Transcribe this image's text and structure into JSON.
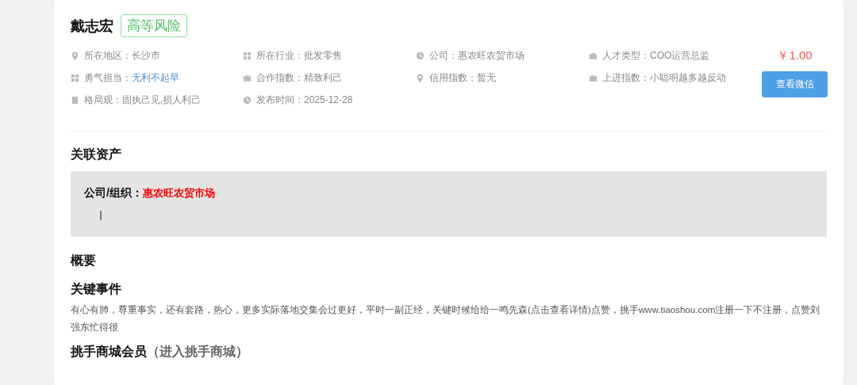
{
  "profile": {
    "name": "戴志宏",
    "risk_tag": "高等风险",
    "price": "￥1.00",
    "button": "查看微信",
    "fields": [
      {
        "kind": "pin",
        "label": "所在地区：",
        "value": "长沙市",
        "link": false
      },
      {
        "kind": "grid",
        "label": "所在行业：",
        "value": "批发零售",
        "link": false
      },
      {
        "kind": "clock",
        "label": "公司：",
        "value": "惠农旺农贸市场",
        "link": false
      },
      {
        "kind": "briefcase",
        "label": "人才类型：",
        "value": "COO运营总监",
        "link": false
      },
      {
        "kind": "grid",
        "label": "勇气担当：",
        "value": "无利不起早",
        "link": true
      },
      {
        "kind": "briefcase",
        "label": "合作指数：",
        "value": "精致利己",
        "link": false
      },
      {
        "kind": "pin",
        "label": "信用指数：",
        "value": "暂无",
        "link": false
      },
      {
        "kind": "briefcase",
        "label": "上进指数：",
        "value": "小聪明越多越反动",
        "link": false
      },
      {
        "kind": "doc",
        "label": "格局观：",
        "value": "固执己见,损人利己",
        "link": false
      },
      {
        "kind": "clock",
        "label": "发布时间：",
        "value": "2025-12-28",
        "link": false
      }
    ]
  },
  "assets": {
    "heading": "关联资产",
    "label": "公司/组织：",
    "value": "惠农旺农贸市场"
  },
  "summary": {
    "heading": "概要"
  },
  "key_events": {
    "heading": "关键事件",
    "text": "有心有肺，尊重事实，还有套路，热心，更多实际落地交集会过更好，平时一副正经，关键时候给给一鸣先森(点击查看详情)点赞，挑手www.tiaoshou.com注册一下不注册，点赞刘强东忙得很"
  },
  "membership": {
    "heading": "挑手商城会员",
    "link": "（进入挑手商城）"
  }
}
